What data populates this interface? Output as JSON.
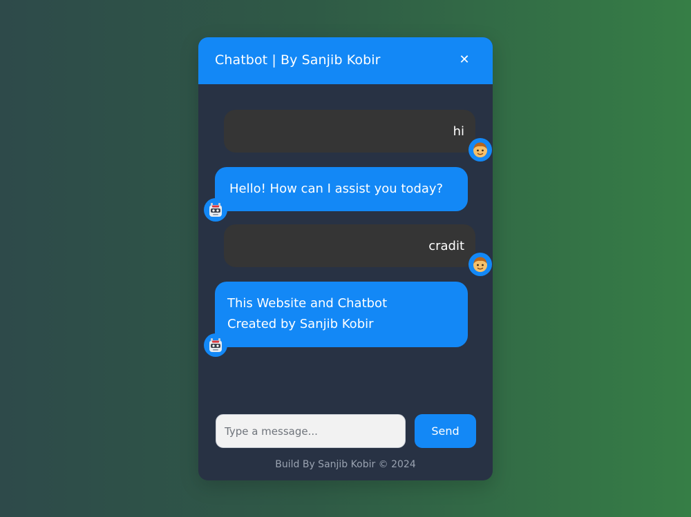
{
  "chat": {
    "header_title": "Chatbot | By Sanjib Kobir",
    "close_label": "✕",
    "messages": [
      {
        "sender": "user",
        "text": "hi",
        "avatar_icon": "user-face-icon"
      },
      {
        "sender": "bot",
        "text": "Hello! How can I assist you today?",
        "avatar_icon": "robot-icon"
      },
      {
        "sender": "user",
        "text": "cradit",
        "avatar_icon": "user-face-icon"
      },
      {
        "sender": "bot",
        "lines": [
          "This Website and Chatbot",
          "Created by Sanjib Kobir"
        ],
        "avatar_icon": "robot-icon"
      }
    ],
    "input_placeholder": "Type a message...",
    "send_label": "Send",
    "footer": "Build By Sanjib Kobir © 2024"
  },
  "colors": {
    "accent": "#1388f6",
    "window_bg": "#283244",
    "user_bubble": "#353535",
    "footer_text": "#9aa3b1"
  }
}
